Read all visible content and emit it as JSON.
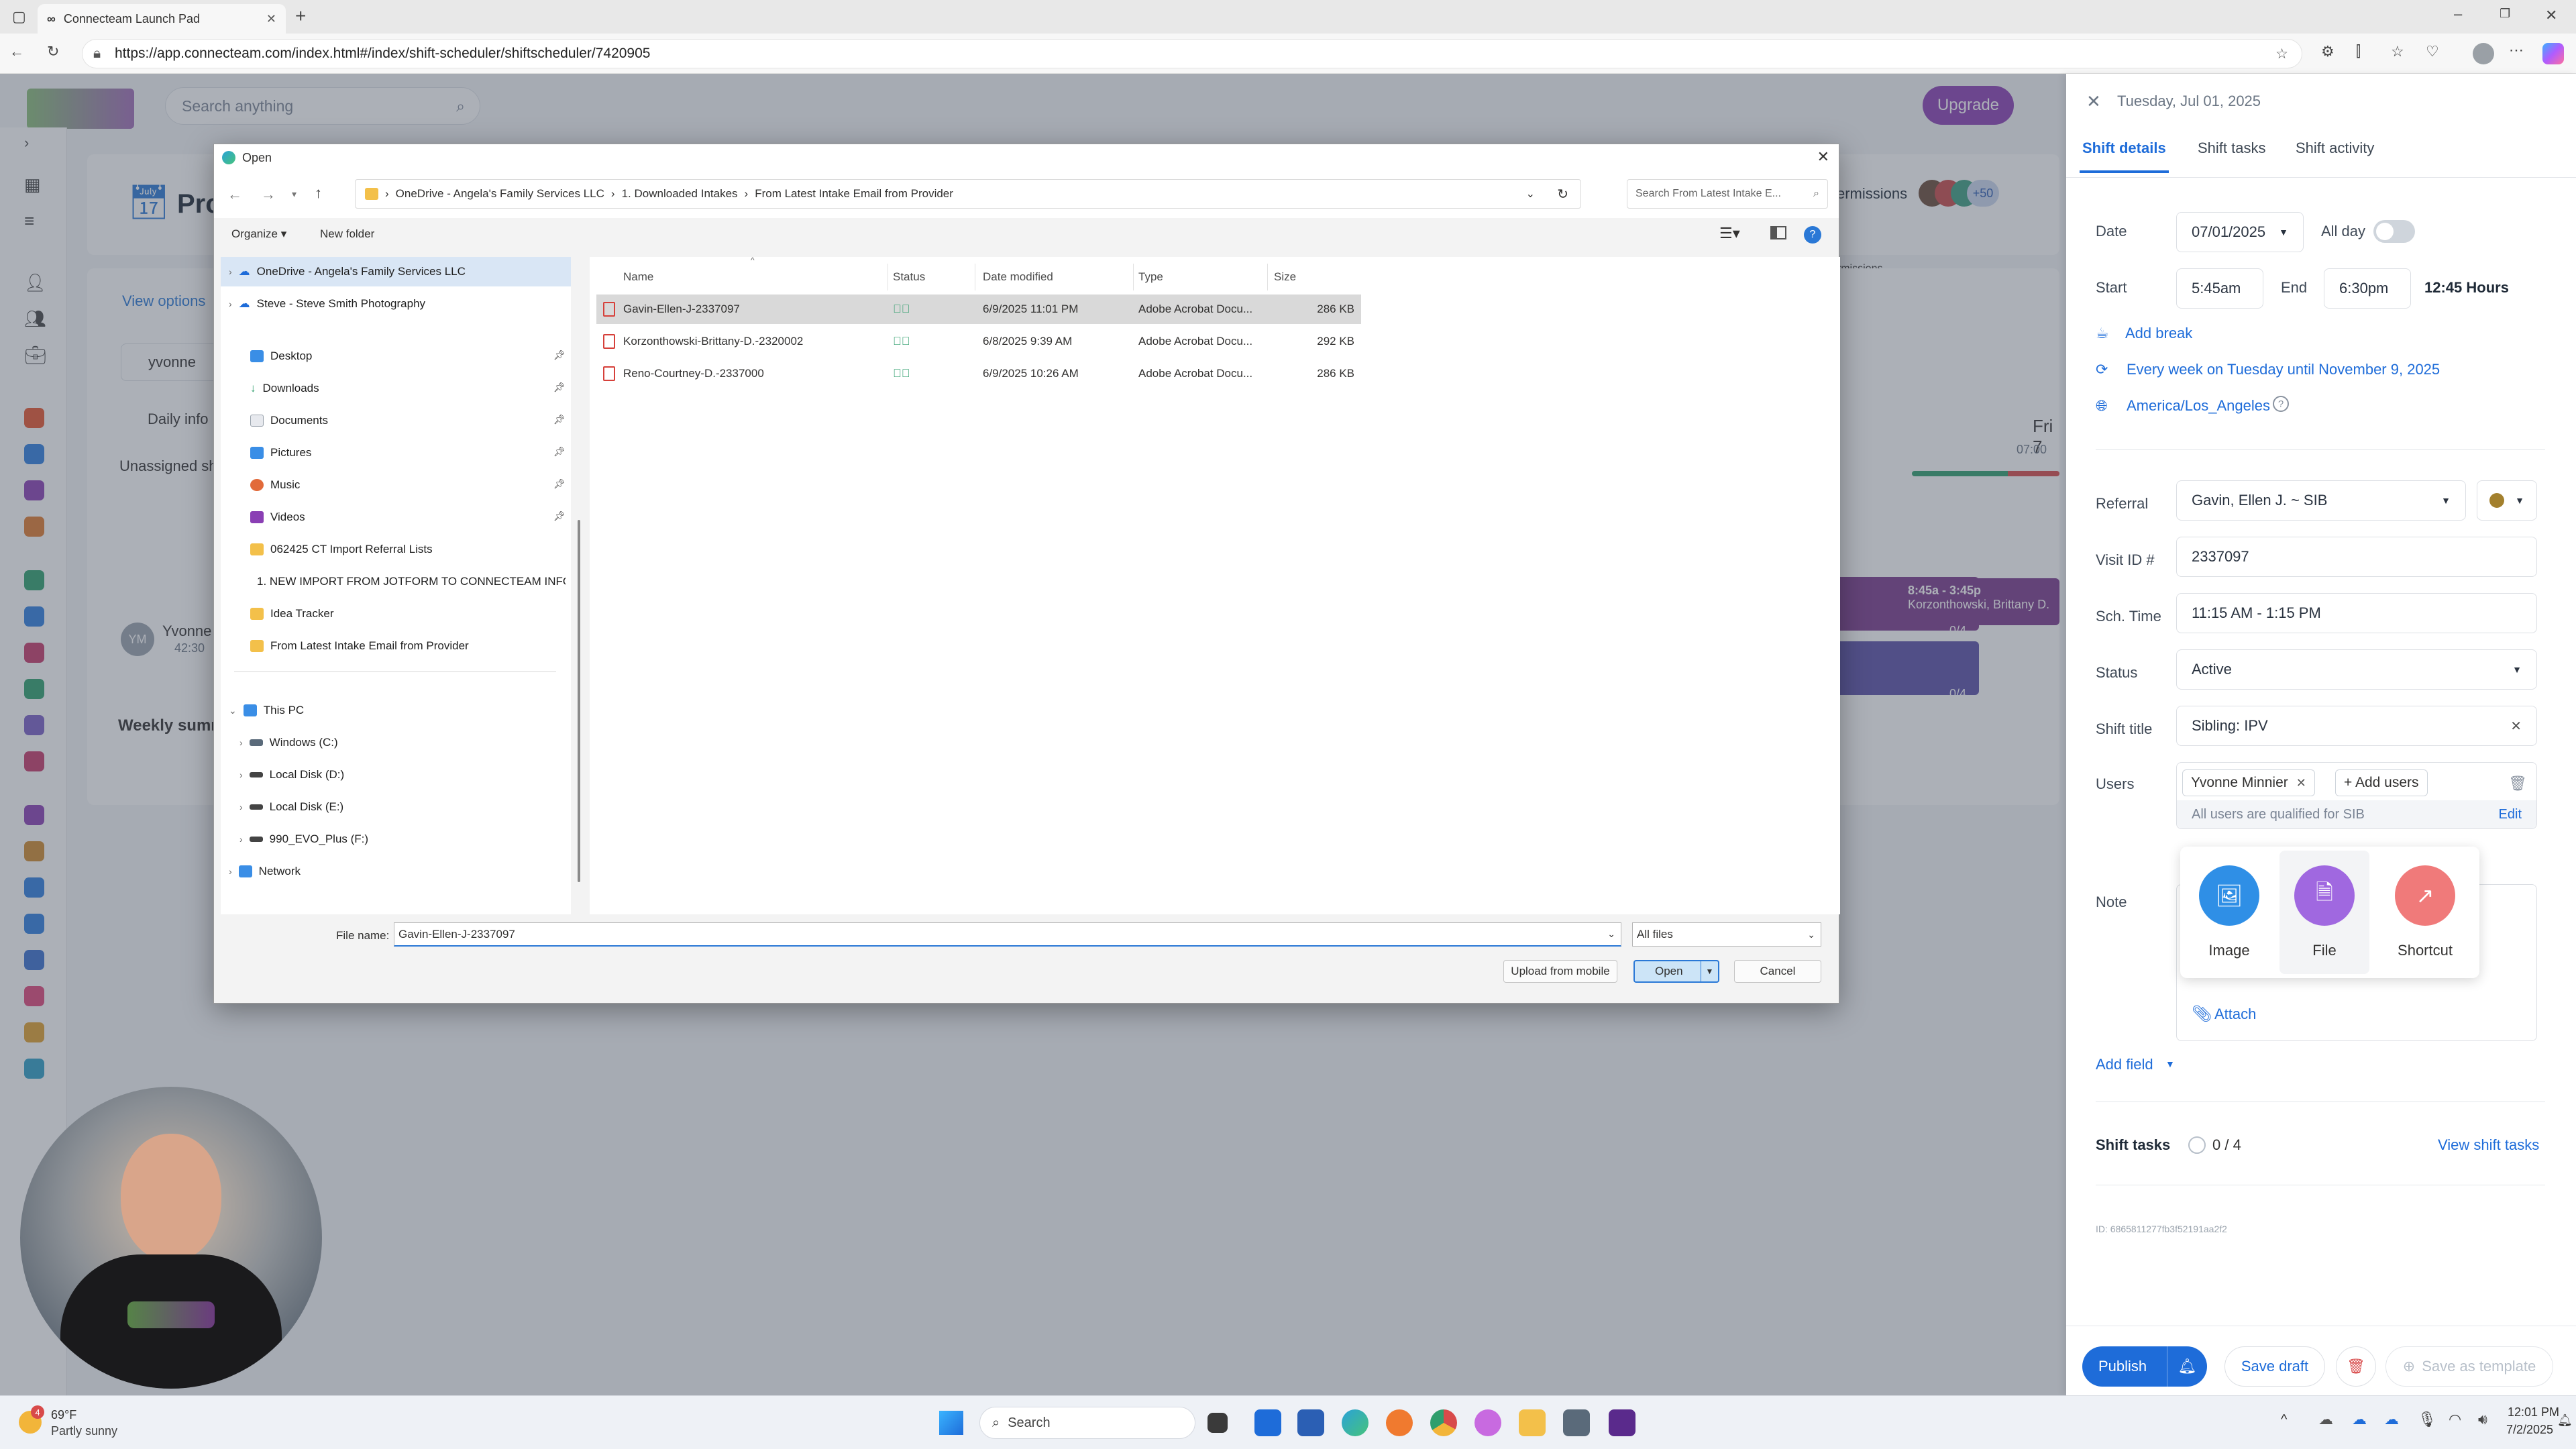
{
  "browser": {
    "tab_title": "Connecteam Launch Pad",
    "url": "https://app.connecteam.com/index.html#/index/shift-scheduler/shiftscheduler/7420905"
  },
  "app": {
    "search_placeholder": "Search anything",
    "upgrade_label": "Upgrade",
    "page_title_partial": "Pro",
    "view_options": "View options",
    "search_value": "yvonne",
    "daily_info": "Daily info",
    "unassigned": "Unassigned sh",
    "user_initials": "YM",
    "user_name_partial": "Yvonne",
    "user_hours_partial": "42:30",
    "weekly_summary": "Weekly summ",
    "permissions_partial": "ermissions",
    "avatar_count": "+50",
    "day_header": "Fri 7",
    "day_time": "07:00",
    "shift_card_time": "8:45a - 3:45p",
    "shift_card_name": "Korzonthowski, Brittany D.",
    "count_badge_1": "0/4",
    "count_badge_2": "0/4"
  },
  "panel": {
    "date_header": "Tuesday, Jul 01, 2025",
    "tabs": [
      "Shift details",
      "Shift tasks",
      "Shift activity"
    ],
    "date_label": "Date",
    "date_value": "07/01/2025",
    "allday_label": "All day",
    "start_label": "Start",
    "start_value": "5:45am",
    "end_label": "End",
    "end_value": "6:30pm",
    "hours": "12:45 Hours",
    "add_break": "Add break",
    "repeat": "Every week on Tuesday until November 9, 2025",
    "timezone": "America/Los_Angeles",
    "referral_label": "Referral",
    "referral_value": "Gavin, Ellen J. ~ SIB",
    "visit_label": "Visit ID #",
    "visit_value": "2337097",
    "sch_label": "Sch. Time",
    "sch_value": "11:15 AM - 1:15 PM",
    "status_label": "Status",
    "status_value": "Active",
    "title_label": "Shift title",
    "title_value": "Sibling: IPV",
    "users_label": "Users",
    "user_chip": "Yvonne Minnier",
    "add_users": "+ Add users",
    "qualified": "All users are qualified for SIB",
    "edit": "Edit",
    "note_label": "Note",
    "attach_options": [
      "Image",
      "File",
      "Shortcut"
    ],
    "attach": "Attach",
    "add_field": "Add field",
    "shift_tasks_label": "Shift tasks",
    "tasks_count": "0 / 4",
    "view_tasks": "View shift tasks",
    "id_text": "ID: 6865811277fb3f52191aa2f2",
    "publish": "Publish",
    "save_draft": "Save draft",
    "save_template": "Save as template"
  },
  "dialog": {
    "title": "Open",
    "breadcrumb": [
      "OneDrive - Angela's Family Services LLC",
      "1. Downloaded Intakes",
      "From Latest Intake Email from Provider"
    ],
    "search_placeholder": "Search From Latest Intake E...",
    "organize": "Organize",
    "new_folder": "New folder",
    "nav_items": [
      "OneDrive - Angela's Family Services LLC",
      "Steve - Steve Smith Photography",
      "Desktop",
      "Downloads",
      "Documents",
      "Pictures",
      "Music",
      "Videos",
      "062425 CT Import Referral Lists",
      "1. NEW IMPORT FROM JOTFORM TO CONNECTEAM INFO",
      "Idea Tracker",
      "From Latest Intake Email from Provider",
      "This PC",
      "Windows (C:)",
      "Local Disk (D:)",
      "Local Disk (E:)",
      "990_EVO_Plus (F:)",
      "Network"
    ],
    "columns": [
      "Name",
      "Status",
      "Date modified",
      "Type",
      "Size"
    ],
    "files": [
      {
        "name": "Gavin-Ellen-J-2337097",
        "date": "6/9/2025 11:01 PM",
        "type": "Adobe Acrobat Docu...",
        "size": "286 KB"
      },
      {
        "name": "Korzonthowski-Brittany-D.-2320002",
        "date": "6/8/2025 9:39 AM",
        "type": "Adobe Acrobat Docu...",
        "size": "292 KB"
      },
      {
        "name": "Reno-Courtney-D.-2337000",
        "date": "6/9/2025 10:26 AM",
        "type": "Adobe Acrobat Docu...",
        "size": "286 KB"
      }
    ],
    "filename_label": "File name:",
    "filename_value": "Gavin-Ellen-J-2337097",
    "filter": "All files",
    "upload_mobile": "Upload from mobile",
    "open": "Open",
    "cancel": "Cancel"
  },
  "taskbar": {
    "weather_temp": "69°F",
    "weather_desc": "Partly sunny",
    "weather_badge": "4",
    "search": "Search",
    "time": "12:01 PM",
    "date": "7/2/2025"
  }
}
